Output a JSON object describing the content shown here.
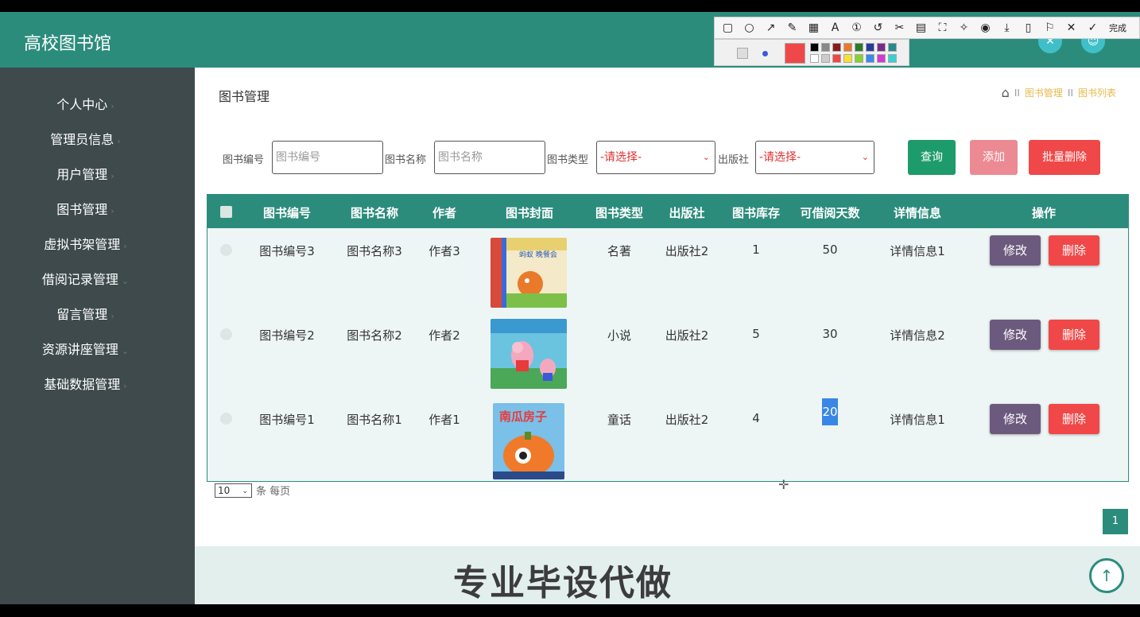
{
  "app": {
    "title": "高校图书馆"
  },
  "sidebar": {
    "items": [
      {
        "label": "个人中心"
      },
      {
        "label": "管理员信息"
      },
      {
        "label": "用户管理"
      },
      {
        "label": "图书管理"
      },
      {
        "label": "虚拟书架管理"
      },
      {
        "label": "借阅记录管理"
      },
      {
        "label": "留言管理"
      },
      {
        "label": "资源讲座管理"
      },
      {
        "label": "基础数据管理"
      }
    ]
  },
  "page": {
    "title": "图书管理",
    "breadcrumb": {
      "separator": "II",
      "items": [
        "图书管理",
        "图书列表"
      ]
    }
  },
  "filters": {
    "book_no_label": "图书编号",
    "book_no_placeholder": "图书编号",
    "book_name_label": "图书名称",
    "book_name_placeholder": "图书名称",
    "book_type_label": "图书类型",
    "book_type_value": "-请选择-",
    "publisher_label": "出版社",
    "publisher_value": "-请选择-",
    "search_label": "查询",
    "add_label": "添加",
    "batch_delete_label": "批量删除"
  },
  "table": {
    "headers": [
      "图书编号",
      "图书名称",
      "作者",
      "图书封面",
      "图书类型",
      "出版社",
      "图书库存",
      "可借阅天数",
      "详情信息",
      "操作"
    ],
    "edit_label": "修改",
    "delete_label": "删除",
    "rows": [
      {
        "no": "图书编号3",
        "name": "图书名称3",
        "author": "作者3",
        "cover_text": "蚂蚁 晚餐会",
        "type": "名著",
        "publisher": "出版社2",
        "stock": "1",
        "days": "50",
        "detail": "详情信息1"
      },
      {
        "no": "图书编号2",
        "name": "图书名称2",
        "author": "作者2",
        "cover_text": "",
        "type": "小说",
        "publisher": "出版社2",
        "stock": "5",
        "days": "30",
        "detail": "详情信息2"
      },
      {
        "no": "图书编号1",
        "name": "图书名称1",
        "author": "作者1",
        "cover_text": "南瓜房子",
        "type": "童话",
        "publisher": "出版社2",
        "stock": "4",
        "days": "20",
        "detail": "详情信息1"
      }
    ]
  },
  "pagination": {
    "page_size": "10",
    "per_page_label": "条 每页",
    "current_page": "1"
  },
  "footer": {
    "watermark": "专业毕设代做"
  },
  "screenshot_toolbar": {
    "done_label": "完成"
  },
  "colors": {
    "primary": "#2c8c7c",
    "sidebar": "#3e4a4c",
    "search": "#1e9b6a",
    "add": "#ec8a93",
    "danger": "#f04848",
    "edit": "#6b5a7e"
  }
}
